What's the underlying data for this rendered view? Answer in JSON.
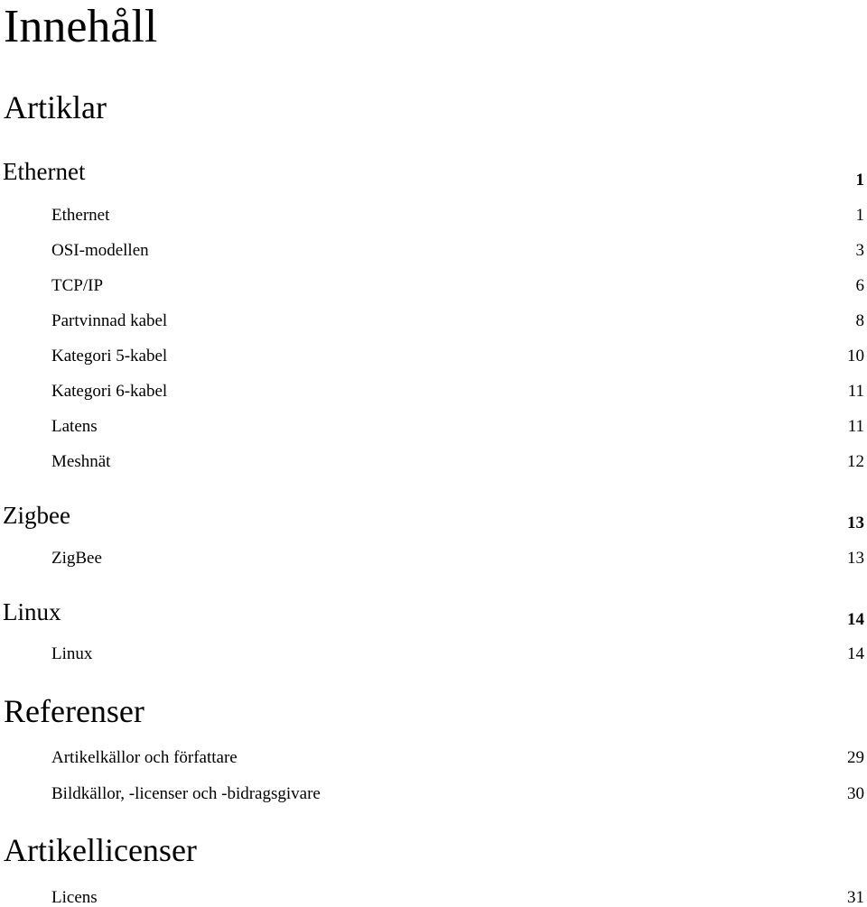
{
  "title": "Innehåll",
  "sections": {
    "artiklar": {
      "heading": "Artiklar",
      "groups": [
        {
          "heading": "Ethernet",
          "page": "1",
          "entries": [
            {
              "label": "Ethernet",
              "page": "1"
            },
            {
              "label": "OSI-modellen",
              "page": "3"
            },
            {
              "label": "TCP/IP",
              "page": "6"
            },
            {
              "label": "Partvinnad kabel",
              "page": "8"
            },
            {
              "label": "Kategori 5-kabel",
              "page": "10"
            },
            {
              "label": "Kategori 6-kabel",
              "page": "11"
            },
            {
              "label": "Latens",
              "page": "11"
            },
            {
              "label": "Meshnät",
              "page": "12"
            }
          ]
        },
        {
          "heading": "Zigbee",
          "page": "13",
          "entries": [
            {
              "label": "ZigBee",
              "page": "13"
            }
          ]
        },
        {
          "heading": "Linux",
          "page": "14",
          "entries": [
            {
              "label": "Linux",
              "page": "14"
            }
          ]
        }
      ]
    },
    "referenser": {
      "heading": "Referenser",
      "entries": [
        {
          "label": "Artikelkällor och författare",
          "page": "29"
        },
        {
          "label": "Bildkällor, -licenser och -bidragsgivare",
          "page": "30"
        }
      ]
    },
    "artikellicenser": {
      "heading": "Artikellicenser",
      "entries": [
        {
          "label": "Licens",
          "page": "31"
        }
      ]
    }
  }
}
